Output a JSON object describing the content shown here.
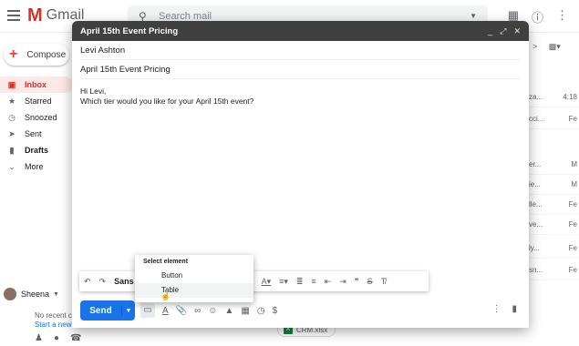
{
  "gmail": {
    "logo_text": "Gmail",
    "search_placeholder": "Search mail",
    "compose_label": "Compose",
    "nav": [
      {
        "label": "Inbox"
      },
      {
        "label": "Starred"
      },
      {
        "label": "Snoozed"
      },
      {
        "label": "Sent"
      },
      {
        "label": "Drafts"
      },
      {
        "label": "More"
      }
    ],
    "user_name": "Sheena",
    "no_recent": "No recent c",
    "start_new": "Start a new",
    "list_rows": [
      {
        "snippet": "za...",
        "date": "4:18"
      },
      {
        "snippet": "cci...",
        "date": "Fe"
      },
      {
        "snippet": "er...",
        "date": "M"
      },
      {
        "snippet": "ie...",
        "date": "M"
      },
      {
        "snippet": "lle...",
        "date": "Fe"
      },
      {
        "snippet": "ve...",
        "date": "Fe"
      },
      {
        "snippet": "ly...",
        "date": "Fe"
      },
      {
        "snippet": "sn...",
        "date": "Fe"
      }
    ],
    "attachment": "CRM.xlsx"
  },
  "compose": {
    "title": "April 15th Event Pricing",
    "to": "Levi Ashton",
    "subject": "April 15th Event Pricing",
    "body_line1": "Hi Levi,",
    "body_line2": "Which tier would you like for your April 15th event?",
    "font_name": "Sans",
    "send_label": "Send"
  },
  "popup": {
    "header": "Select element",
    "options": [
      {
        "label": "Button"
      },
      {
        "label": "Table"
      }
    ]
  }
}
